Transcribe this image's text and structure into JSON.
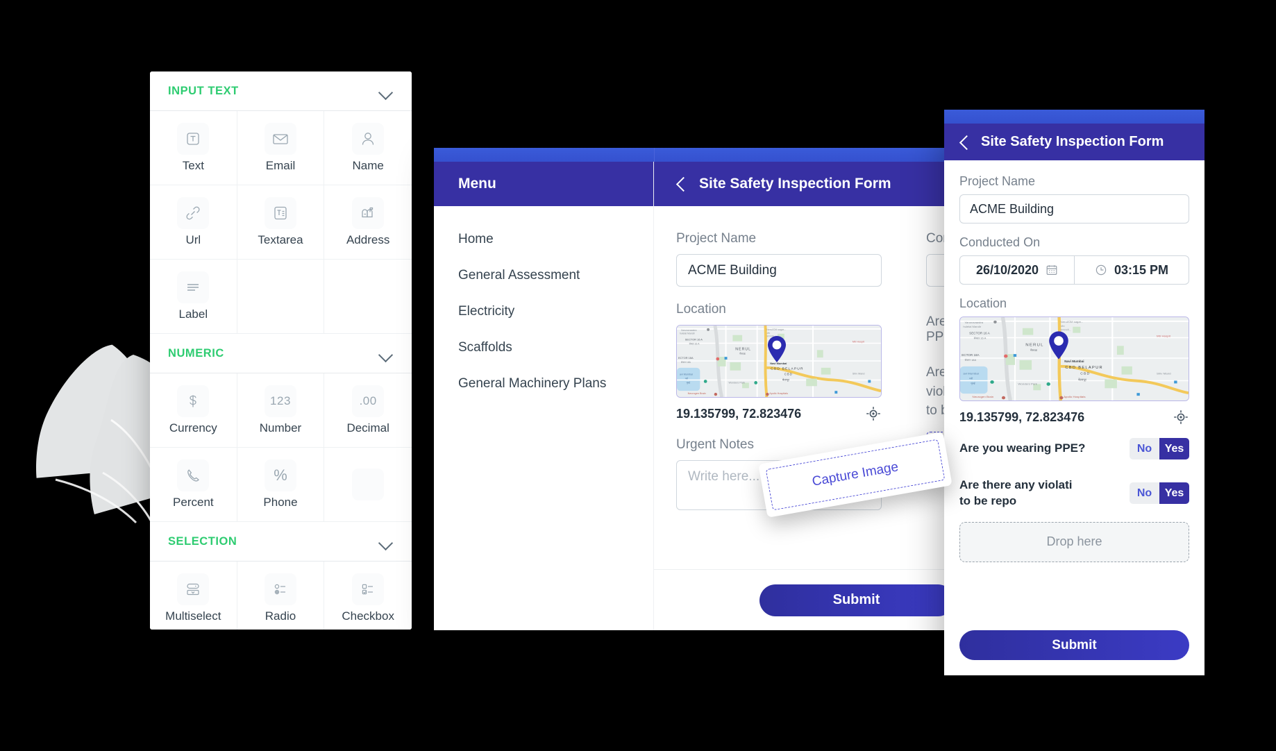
{
  "palette": {
    "sections": [
      {
        "id": "input-text",
        "title": "INPUT TEXT",
        "chevron_icon": "chevron-down-icon",
        "items": [
          {
            "label": "Text",
            "icon": "text-box-icon"
          },
          {
            "label": "Email",
            "icon": "envelope-icon"
          },
          {
            "label": "Name",
            "icon": "person-icon"
          },
          {
            "label": "Url",
            "icon": "link-icon"
          },
          {
            "label": "Textarea",
            "icon": "textarea-icon"
          },
          {
            "label": "Address",
            "icon": "mailbox-icon"
          },
          {
            "label": "Label",
            "icon": "lines-icon"
          },
          {
            "label": "",
            "icon": ""
          },
          {
            "label": "",
            "icon": ""
          }
        ]
      },
      {
        "id": "numeric",
        "title": "NUMERIC",
        "chevron_icon": "chevron-down-icon",
        "items": [
          {
            "label": "Currency",
            "icon": "dollar-icon"
          },
          {
            "label": "Number",
            "icon": "123-icon"
          },
          {
            "label": "Decimal",
            "icon": "decimal-icon"
          },
          {
            "label": "Percent",
            "icon": "phone-handset-icon"
          },
          {
            "label": "Phone",
            "icon": "percent-icon"
          },
          {
            "label": "",
            "icon": ""
          }
        ]
      },
      {
        "id": "selection",
        "title": "SELECTION",
        "chevron_icon": "chevron-down-icon",
        "items": [
          {
            "label": "Multiselect",
            "icon": "multiselect-icon"
          },
          {
            "label": "Radio",
            "icon": "radio-icon"
          },
          {
            "label": "Checkbox",
            "icon": "checkbox-icon"
          }
        ]
      }
    ]
  },
  "desktop": {
    "menu": {
      "title": "Menu",
      "items": [
        {
          "label": "Home"
        },
        {
          "label": "General Assessment"
        },
        {
          "label": "Electricity"
        },
        {
          "label": "Scaffolds"
        },
        {
          "label": "General Machinery Plans"
        }
      ]
    },
    "form": {
      "back_icon": "back-chevron-icon",
      "title": "Site Safety Inspection Form",
      "project_name_label": "Project Name",
      "project_name_value": "ACME Building",
      "location_label": "Location",
      "coordinates": "19.135799, 72.823476",
      "gps_icon": "crosshair-gps-icon",
      "urgent_notes_label": "Urgent Notes",
      "urgent_notes_placeholder": "Write here...",
      "conducted_on_label": "Conducted On",
      "ppe_question": "Are you wearing PPE?",
      "violations_question_line1": "Are there any violations",
      "violations_question_line2": "to be reported?",
      "drop_here": "Drop here",
      "submit_label": "Submit"
    }
  },
  "phone": {
    "back_icon": "back-chevron-icon",
    "title": "Site Safety Inspection Form",
    "project_name_label": "Project Name",
    "project_name_value": "ACME Building",
    "conducted_on_label": "Conducted On",
    "date_value": "26/10/2020",
    "date_icon": "calendar-icon",
    "time_value": "03:15 PM",
    "time_icon": "clock-icon",
    "location_label": "Location",
    "coordinates": "19.135799, 72.823476",
    "gps_icon": "crosshair-gps-icon",
    "ppe_question": "Are you wearing PPE?",
    "ppe_no": "No",
    "ppe_yes": "Yes",
    "violations_question_line1": "Are there any violati",
    "violations_question_line2": "to be repo",
    "violations_no": "No",
    "violations_yes": "Yes",
    "drop_here": "Drop here",
    "submit_label": "Submit"
  },
  "capture_card": {
    "label": "Capture Image"
  },
  "map": {
    "pin_icon": "map-pin-icon",
    "labels": [
      "Varunavaastra",
      "hulelal Mandir",
      "SECTOR 16 A",
      "सेक्टर 16 A",
      "NERUL",
      "नेरूळ",
      "SECTOR 18A",
      "सेक्टर 18A",
      "Nerul/OM sagar...",
      "Mtr Hospit",
      "Navi Mumbai",
      "CBD BELAPUR",
      "CBD",
      "बेलापूर",
      "Shiv Mand",
      "avi Mumbai",
      "Wonders Park",
      "Neurogen Brain",
      "Apollo Hospitals"
    ]
  },
  "colors": {
    "accent_green": "#2ecc71",
    "header_indigo": "#3730a3",
    "strip_blue": "#3a5bd9",
    "submit_gradient_from": "#2f2f9e",
    "submit_gradient_to": "#3b3bc4",
    "dashed_blue": "#4a4ad6",
    "text_dark": "#24303c",
    "text_muted": "#76808c"
  }
}
